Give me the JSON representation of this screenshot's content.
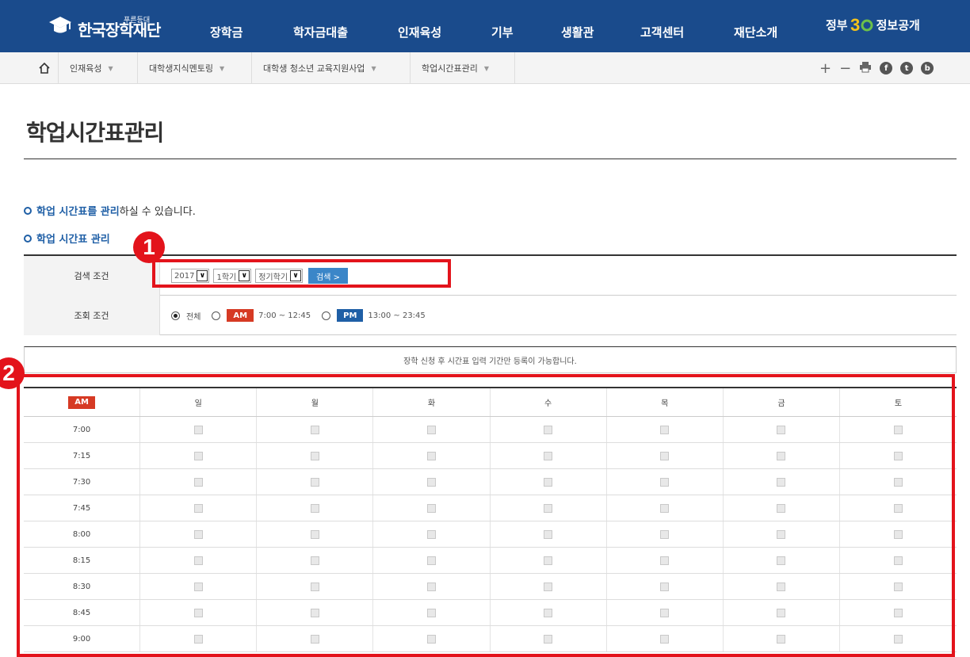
{
  "header": {
    "logo_sub": "푸른등대",
    "logo_text": "한국장학재단",
    "nav": [
      "장학금",
      "학자금대출",
      "인재육성",
      "기부",
      "생활관",
      "고객센터",
      "재단소개"
    ],
    "gov_left": "정부",
    "gov_mid": "3.0",
    "gov_right": "정보공개"
  },
  "breadcrumb": {
    "items": [
      "인재육성",
      "대학생지식멘토링",
      "대학생 청소년 교육지원사업",
      "학업시간표관리"
    ],
    "tools": [
      "+",
      "−"
    ]
  },
  "page": {
    "title": "학업시간표관리",
    "intro_accent": "학업 시간표를 관리",
    "intro_rest": " 하실 수 있습니다.",
    "section": "학업 시간표 관리"
  },
  "search": {
    "label": "검색 조건",
    "year": "2017",
    "semester": "1학기",
    "term_type": "정기학기",
    "button": "검색 >",
    "view_label": "조회 조건",
    "all_label": "전체",
    "am_badge": "AM",
    "am_range": "7:00 ~ 12:45",
    "pm_badge": "PM",
    "pm_range": "13:00 ~ 23:45"
  },
  "notice": "장학 신청 후 시간표 입력 기간만 등록이 가능합니다.",
  "timetable": {
    "corner": "AM",
    "days": [
      "일",
      "월",
      "화",
      "수",
      "목",
      "금",
      "토"
    ],
    "times": [
      "7:00",
      "7:15",
      "7:30",
      "7:45",
      "8:00",
      "8:15",
      "8:30",
      "8:45",
      "9:00"
    ]
  },
  "annotations": [
    "1",
    "2"
  ],
  "colors": {
    "nav_bg": "#1a4b8c",
    "accent": "#1f5fa6",
    "am": "#d63a24",
    "highlight": "#e3131b"
  }
}
